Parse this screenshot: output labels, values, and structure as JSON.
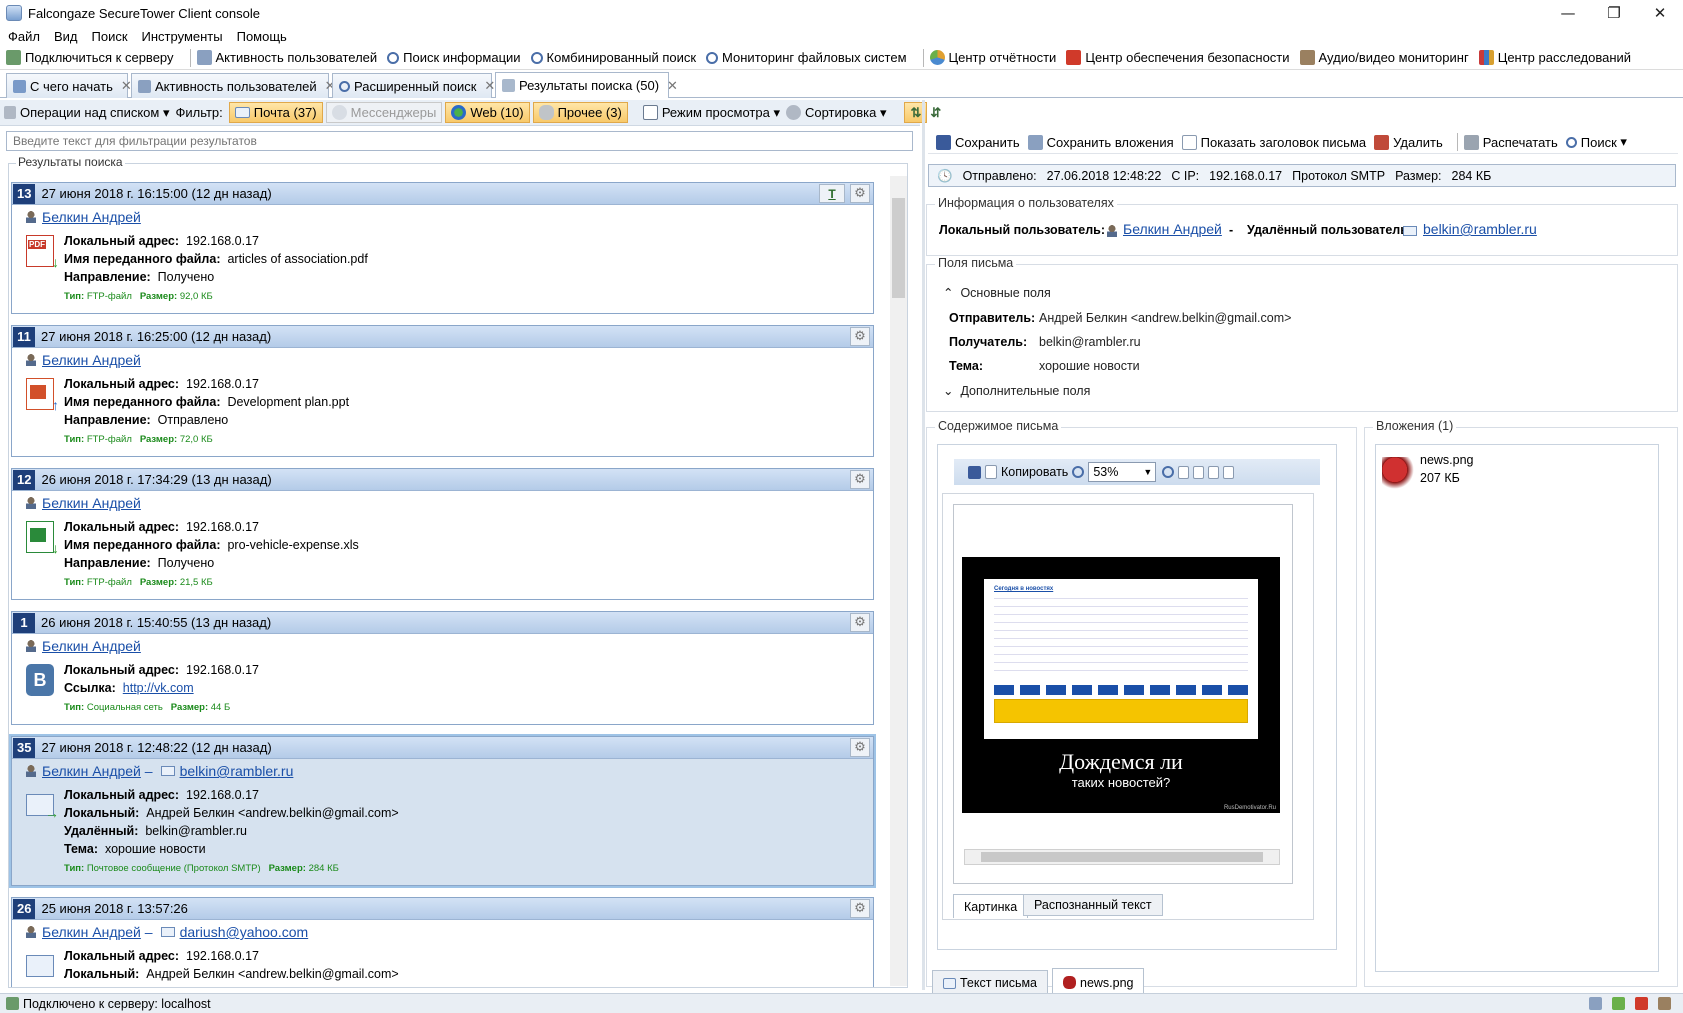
{
  "window": {
    "title": "Falcongaze SecureTower Client console",
    "minimize": "—",
    "maximize": "❐",
    "close": "✕"
  },
  "menu": [
    "Файл",
    "Вид",
    "Поиск",
    "Инструменты",
    "Помощь"
  ],
  "toolbar": {
    "connect": "Подключиться к серверу",
    "activity": "Активность пользователей",
    "search_info": "Поиск информации",
    "combined": "Комбинированный поиск",
    "fs_monitor": "Мониторинг файловых систем",
    "reports": "Центр отчётности",
    "security": "Центр обеспечения безопасности",
    "av_monitor": "Аудио/видео мониторинг",
    "investigations": "Центр расследований"
  },
  "tabs": [
    {
      "label": "С чего начать"
    },
    {
      "label": "Активность пользователей"
    },
    {
      "label": "Расширенный поиск"
    },
    {
      "label": "Результаты поиска (50)"
    }
  ],
  "list_toolbar": {
    "ops": "Операции над списком",
    "filter": "Фильтр:",
    "mail": "Почта (37)",
    "messengers": "Мессенджеры",
    "web": "Web (10)",
    "other": "Прочее (3)",
    "view_mode": "Режим просмотра",
    "sort": "Сортировка"
  },
  "filter_placeholder": "Введите текст для фильтрации результатов",
  "results_label": "Результаты поиска",
  "cards": [
    {
      "num": "13",
      "date": "27 июня 2018 г. 16:15:00 (12 дн назад)",
      "user": "Белкин Андрей",
      "l1": "Локальный адрес:",
      "v1": "192.168.0.17",
      "l2": "Имя переданного файла:",
      "v2": "articles of association.pdf",
      "l3": "Направление:",
      "v3": "Получено",
      "type_l": "Тип:",
      "type_v": "FTP-файл",
      "size_l": "Размер:",
      "size_v": "92,0 КБ",
      "tbtn": "T"
    },
    {
      "num": "11",
      "date": "27 июня 2018 г. 16:25:00 (12 дн назад)",
      "user": "Белкин Андрей",
      "l1": "Локальный адрес:",
      "v1": "192.168.0.17",
      "l2": "Имя переданного файла:",
      "v2": "Development plan.ppt",
      "l3": "Направление:",
      "v3": "Отправлено",
      "type_l": "Тип:",
      "type_v": "FTP-файл",
      "size_l": "Размер:",
      "size_v": "72,0 КБ"
    },
    {
      "num": "12",
      "date": "26 июня 2018 г. 17:34:29 (13 дн назад)",
      "user": "Белкин Андрей",
      "l1": "Локальный адрес:",
      "v1": "192.168.0.17",
      "l2": "Имя переданного файла:",
      "v2": "pro-vehicle-expense.xls",
      "l3": "Направление:",
      "v3": "Получено",
      "type_l": "Тип:",
      "type_v": "FTP-файл",
      "size_l": "Размер:",
      "size_v": "21,5 КБ"
    },
    {
      "num": "1",
      "date": "26 июня 2018 г. 15:40:55 (13 дн назад)",
      "user": "Белкин Андрей",
      "l1": "Локальный адрес:",
      "v1": "192.168.0.17",
      "l2": "Ссылка:",
      "v2": "http://vk.com",
      "type_l": "Тип:",
      "type_v": "Социальная сеть",
      "size_l": "Размер:",
      "size_v": "44 Б"
    },
    {
      "num": "35",
      "date": "27 июня 2018 г. 12:48:22 (12 дн назад)",
      "user": "Белкин Андрей",
      "dash": "–",
      "email": "belkin@rambler.ru",
      "l1": "Локальный адрес:",
      "v1": "192.168.0.17",
      "l2": "Локальный:",
      "v2": "Андрей Белкин <andrew.belkin@gmail.com>",
      "l3": "Удалённый:",
      "v3": "belkin@rambler.ru",
      "l4": "Тема:",
      "v4": "хорошие новости",
      "type_l": "Тип:",
      "type_v": "Почтовое сообщение (Протокол SMTP)",
      "size_l": "Размер:",
      "size_v": "284 КБ"
    },
    {
      "num": "26",
      "date": "25 июня 2018 г. 13:57:26",
      "user": "Белкин Андрей",
      "dash": "–",
      "email": "dariush@yahoo.com",
      "l1": "Локальный адрес:",
      "v1": "192.168.0.17",
      "l2": "Локальный:",
      "v2": "Андрей Белкин <andrew.belkin@gmail.com>"
    }
  ],
  "right_toolbar": {
    "save": "Сохранить",
    "save_att": "Сохранить вложения",
    "show_header": "Показать заголовок письма",
    "delete": "Удалить",
    "print": "Распечатать",
    "search": "Поиск"
  },
  "info": {
    "sent_l": "Отправлено:",
    "sent_v": "27.06.2018 12:48:22",
    "ip_l": "С IP:",
    "ip_v": "192.168.0.17",
    "proto": "Протокол SMTP",
    "size_l": "Размер:",
    "size_v": "284 КБ"
  },
  "users_section": {
    "title": "Информация о пользователях",
    "local_l": "Локальный пользователь:",
    "local_v": "Белкин Андрей",
    "dash": "-",
    "remote_l": "Удалённый пользователь:",
    "remote_v": "belkin@rambler.ru"
  },
  "fields_section": {
    "title": "Поля письма",
    "main": "Основные поля",
    "sender_l": "Отправитель:",
    "sender_v": "Андрей Белкин <andrew.belkin@gmail.com>",
    "recipient_l": "Получатель:",
    "recipient_v": "belkin@rambler.ru",
    "subject_l": "Тема:",
    "subject_v": "хорошие новости",
    "extra": "Дополнительные поля"
  },
  "content_section": {
    "title": "Содержимое письма",
    "copy": "Копировать",
    "zoom": "53%",
    "tab_picture": "Картинка",
    "tab_ocr": "Распознанный текст",
    "tab_text": "Текст письма",
    "tab_png": "news.png",
    "img_line1": "Дождемся ли",
    "img_line2": "таких новостей?",
    "img_site": "RusDemotivator.Ru",
    "img_header": "Сегодня в новостях"
  },
  "attachments": {
    "title": "Вложения (1)",
    "name": "news.png",
    "size": "207 КБ"
  },
  "status": "Подключено к серверу: localhost",
  "colors": {
    "accent": "#1e3f7a",
    "link": "#1a4fa8",
    "meta": "#1a8a1a",
    "chip": "#f8c96a"
  }
}
